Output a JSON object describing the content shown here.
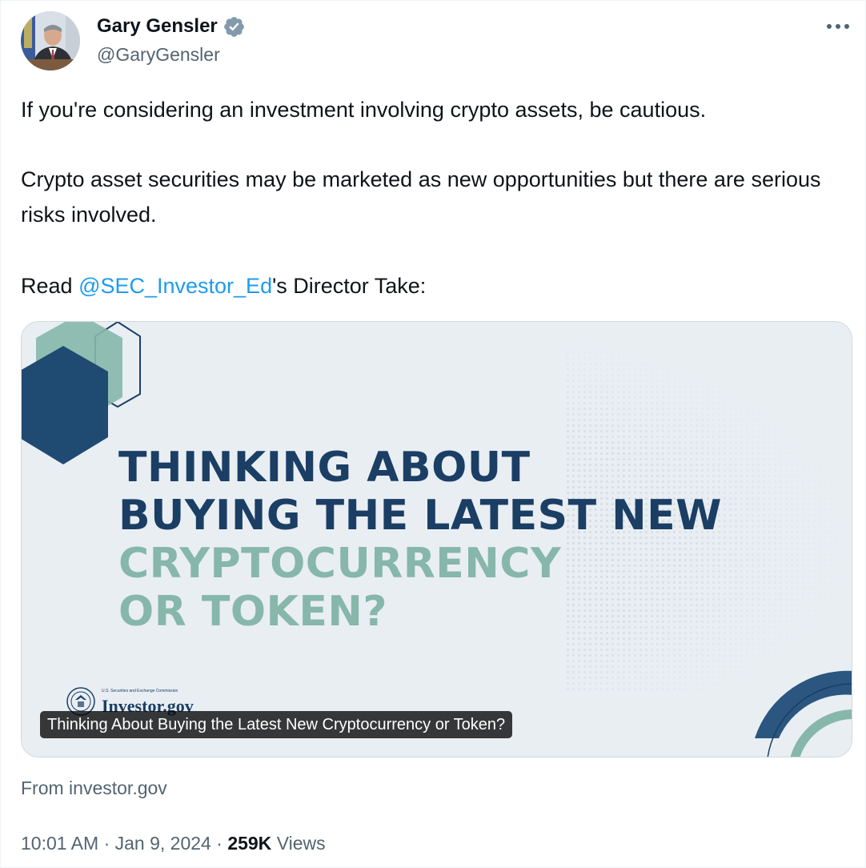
{
  "author": {
    "display_name": "Gary Gensler",
    "handle": "@GaryGensler",
    "verified": true,
    "verified_badge_color": "#829aab"
  },
  "more_icon": "ellipsis-horizontal-icon",
  "tweet": {
    "line1": "If you're considering an investment involving crypto assets, be cautious.",
    "line2": "Crypto asset securities may be marketed as new opportunities but there are serious risks involved.",
    "line3_prefix": "Read ",
    "mention": "@SEC_Investor_Ed",
    "line3_suffix": "'s Director Take:"
  },
  "card": {
    "headline_dark_1": "THINKING ABOUT",
    "headline_dark_2": "BUYING THE LATEST NEW",
    "headline_teal_1": "CRYPTOCURRENCY",
    "headline_teal_2": "OR TOKEN?",
    "logo_small_text": "U.S. Securities and Exchange Commission",
    "logo_text": "Investor.gov",
    "caption": "Thinking About Buying the Latest New Cryptocurrency or Token?",
    "source": "From investor.gov",
    "colors": {
      "navy": "#1b3e64",
      "teal": "#86b7aa",
      "background": "#e9eef3"
    }
  },
  "meta": {
    "time": "10:01 AM",
    "separator": "·",
    "date": "Jan 9, 2024",
    "views_count": "259K",
    "views_label": "Views"
  },
  "colors": {
    "link": "#1d9bf0",
    "secondary_text": "#536471",
    "primary_text": "#0f1419"
  }
}
